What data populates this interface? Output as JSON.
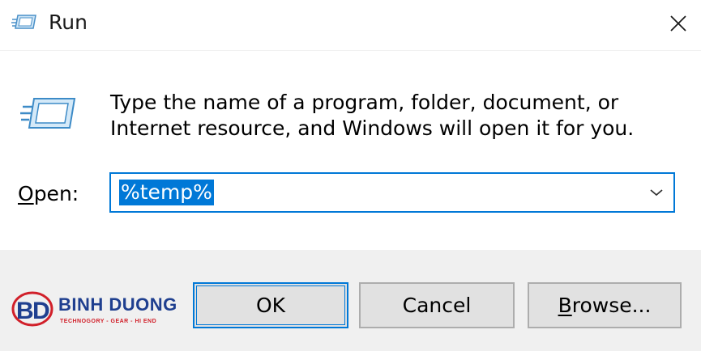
{
  "window": {
    "title": "Run",
    "icon": "run-icon",
    "close_icon": "close-icon"
  },
  "dialog": {
    "description": "Type the name of a program, folder, document, or Internet resource, and Windows will open it for you.",
    "open_label_mnemonic": "O",
    "open_label_rest": "pen:",
    "input_value": "%temp%",
    "dropdown_icon": "chevron-down-icon"
  },
  "buttons": {
    "ok": "OK",
    "cancel": "Cancel",
    "browse_mnemonic": "B",
    "browse_rest": "rowse..."
  },
  "watermark": {
    "name": "BINH DUONG",
    "tagline": "TECHNOGORY - GEAR - HI END"
  },
  "colors": {
    "accent": "#0078d7",
    "footer_bg": "#f0f0f0",
    "button_bg": "#e1e1e1",
    "logo_blue": "#1f3f8f",
    "logo_red": "#d1202a"
  }
}
